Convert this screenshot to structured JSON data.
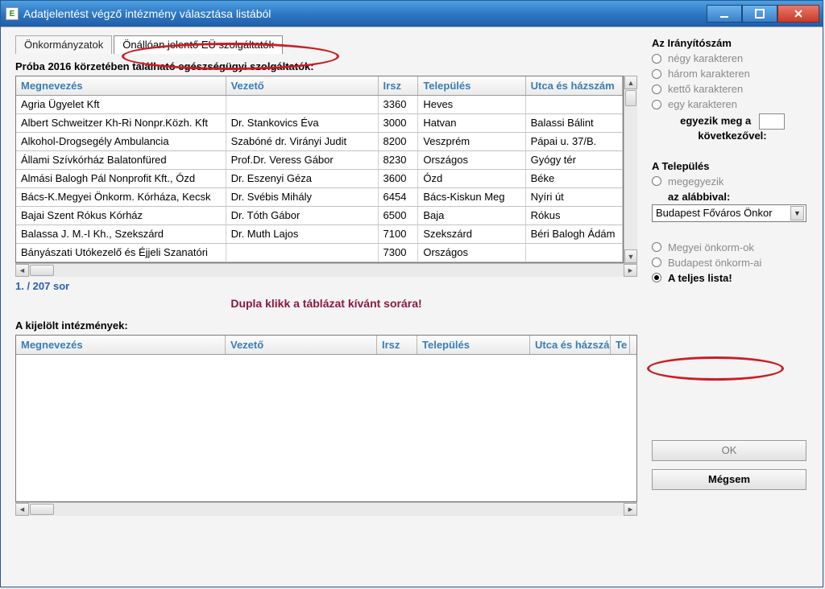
{
  "window": {
    "title": "Adatjelentést végző intézmény választása listából"
  },
  "tabs": {
    "gov": "Önkormányzatok",
    "eu": "Önállóan jelentő EÜ szolgáltatók"
  },
  "sectionTitle": "Próba 2016 körzetében található egészségügyi szolgáltatók:",
  "columns": {
    "name": "Megnevezés",
    "lead": "Vezető",
    "zip": "Irsz",
    "town": "Település",
    "street": "Utca és házszám",
    "te": "Te"
  },
  "rows": [
    {
      "name": "Agria Ügyelet Kft",
      "lead": "",
      "zip": "3360",
      "town": "Heves",
      "street": ""
    },
    {
      "name": "Albert Schweitzer Kh-Ri Nonpr.Közh. Kft",
      "lead": "Dr. Stankovics Éva",
      "zip": "3000",
      "town": "Hatvan",
      "street": "Balassi Bálint"
    },
    {
      "name": "Alkohol-Drogsegély Ambulancia",
      "lead": "Szabóné dr. Virányi Judit",
      "zip": "8200",
      "town": "Veszprém",
      "street": "Pápai u. 37/B."
    },
    {
      "name": "Állami Szívkórház Balatonfüred",
      "lead": "Prof.Dr. Veress Gábor",
      "zip": "8230",
      "town": "Országos",
      "street": "Gyógy tér"
    },
    {
      "name": "Almási Balogh Pál Nonprofit Kft., Ózd",
      "lead": "Dr. Eszenyi Géza",
      "zip": "3600",
      "town": "Ózd",
      "street": "Béke"
    },
    {
      "name": "Bács-K.Megyei Önkorm. Kórháza, Kecsk",
      "lead": "Dr. Svébis Mihály",
      "zip": "6454",
      "town": "Bács-Kiskun Meg",
      "street": "Nyíri út"
    },
    {
      "name": "Bajai Szent Rókus Kórház",
      "lead": "Dr. Tóth Gábor",
      "zip": "6500",
      "town": "Baja",
      "street": "Rókus"
    },
    {
      "name": "Balassa J. M.-I Kh., Szekszárd",
      "lead": "Dr. Muth Lajos",
      "zip": "7100",
      "town": "Szekszárd",
      "street": "Béri Balogh Ádám"
    },
    {
      "name": "Bányászati Utókezelő és Éjjeli Szanatóri",
      "lead": "",
      "zip": "7300",
      "town": "Országos",
      "street": ""
    }
  ],
  "rowCount": "1. / 207 sor",
  "hint": "Dupla klikk a táblázat kívánt sorára!",
  "selectedTitle": "A kijelölt intézmények:",
  "right": {
    "zipTitle": "Az Irányítószám",
    "zip4": "négy karakteren",
    "zip3": "három karakteren",
    "zip2": "kettő karakteren",
    "zip1": "egy karakteren",
    "matchTop": "egyezik meg a",
    "matchBottom": "következővel:",
    "townTitle": "A Település",
    "townMatch": "megegyezik",
    "townBelow": "az alábbival:",
    "dropdown": "Budapest Főváros Önkor",
    "megyei": "Megyei önkorm-ok",
    "budapest": "Budapest önkorm-ai",
    "allList": "A teljes lista!"
  },
  "buttons": {
    "ok": "OK",
    "cancel": "Mégsem"
  }
}
